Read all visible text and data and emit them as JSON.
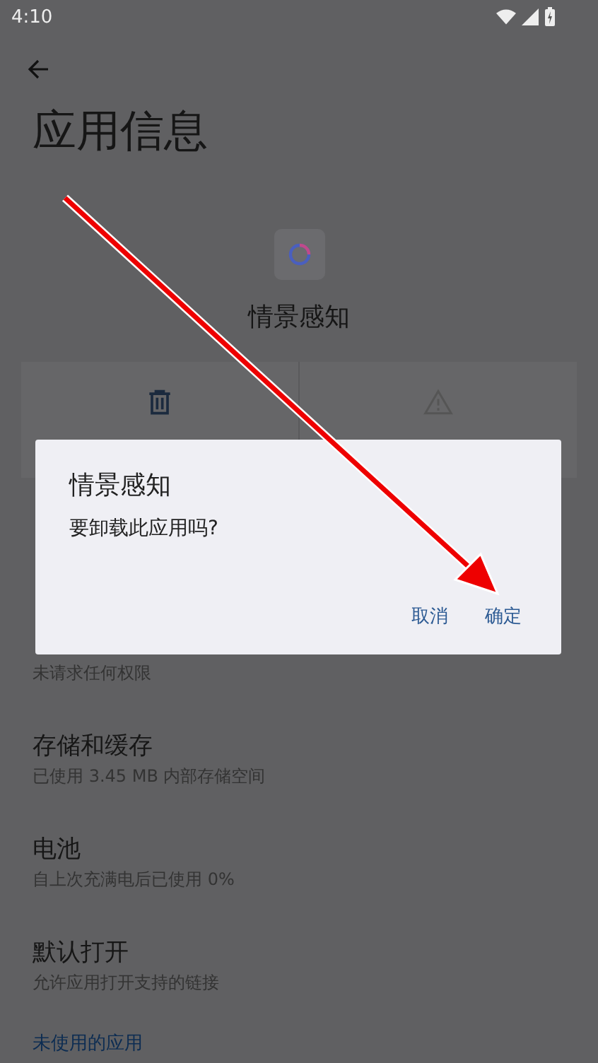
{
  "status_bar": {
    "time": "4:10"
  },
  "page": {
    "title": "应用信息",
    "app_name": "情景感知"
  },
  "actions": [
    {
      "kind": "uninstall"
    },
    {
      "kind": "force_stop"
    }
  ],
  "rows": [
    {
      "kind": "item",
      "subtitle": "未请求任何权限"
    },
    {
      "kind": "item",
      "title": "存储和缓存",
      "subtitle": "已使用 3.45 MB 内部存储空间"
    },
    {
      "kind": "item",
      "title": "电池",
      "subtitle": "自上次充满电后已使用 0%"
    },
    {
      "kind": "item",
      "title": "默认打开",
      "subtitle": "允许应用打开支持的链接"
    },
    {
      "kind": "section",
      "title": "未使用的应用"
    }
  ],
  "dialog": {
    "title": "情景感知",
    "message": "要卸载此应用吗?",
    "buttons": [
      "取消",
      "确定"
    ]
  }
}
